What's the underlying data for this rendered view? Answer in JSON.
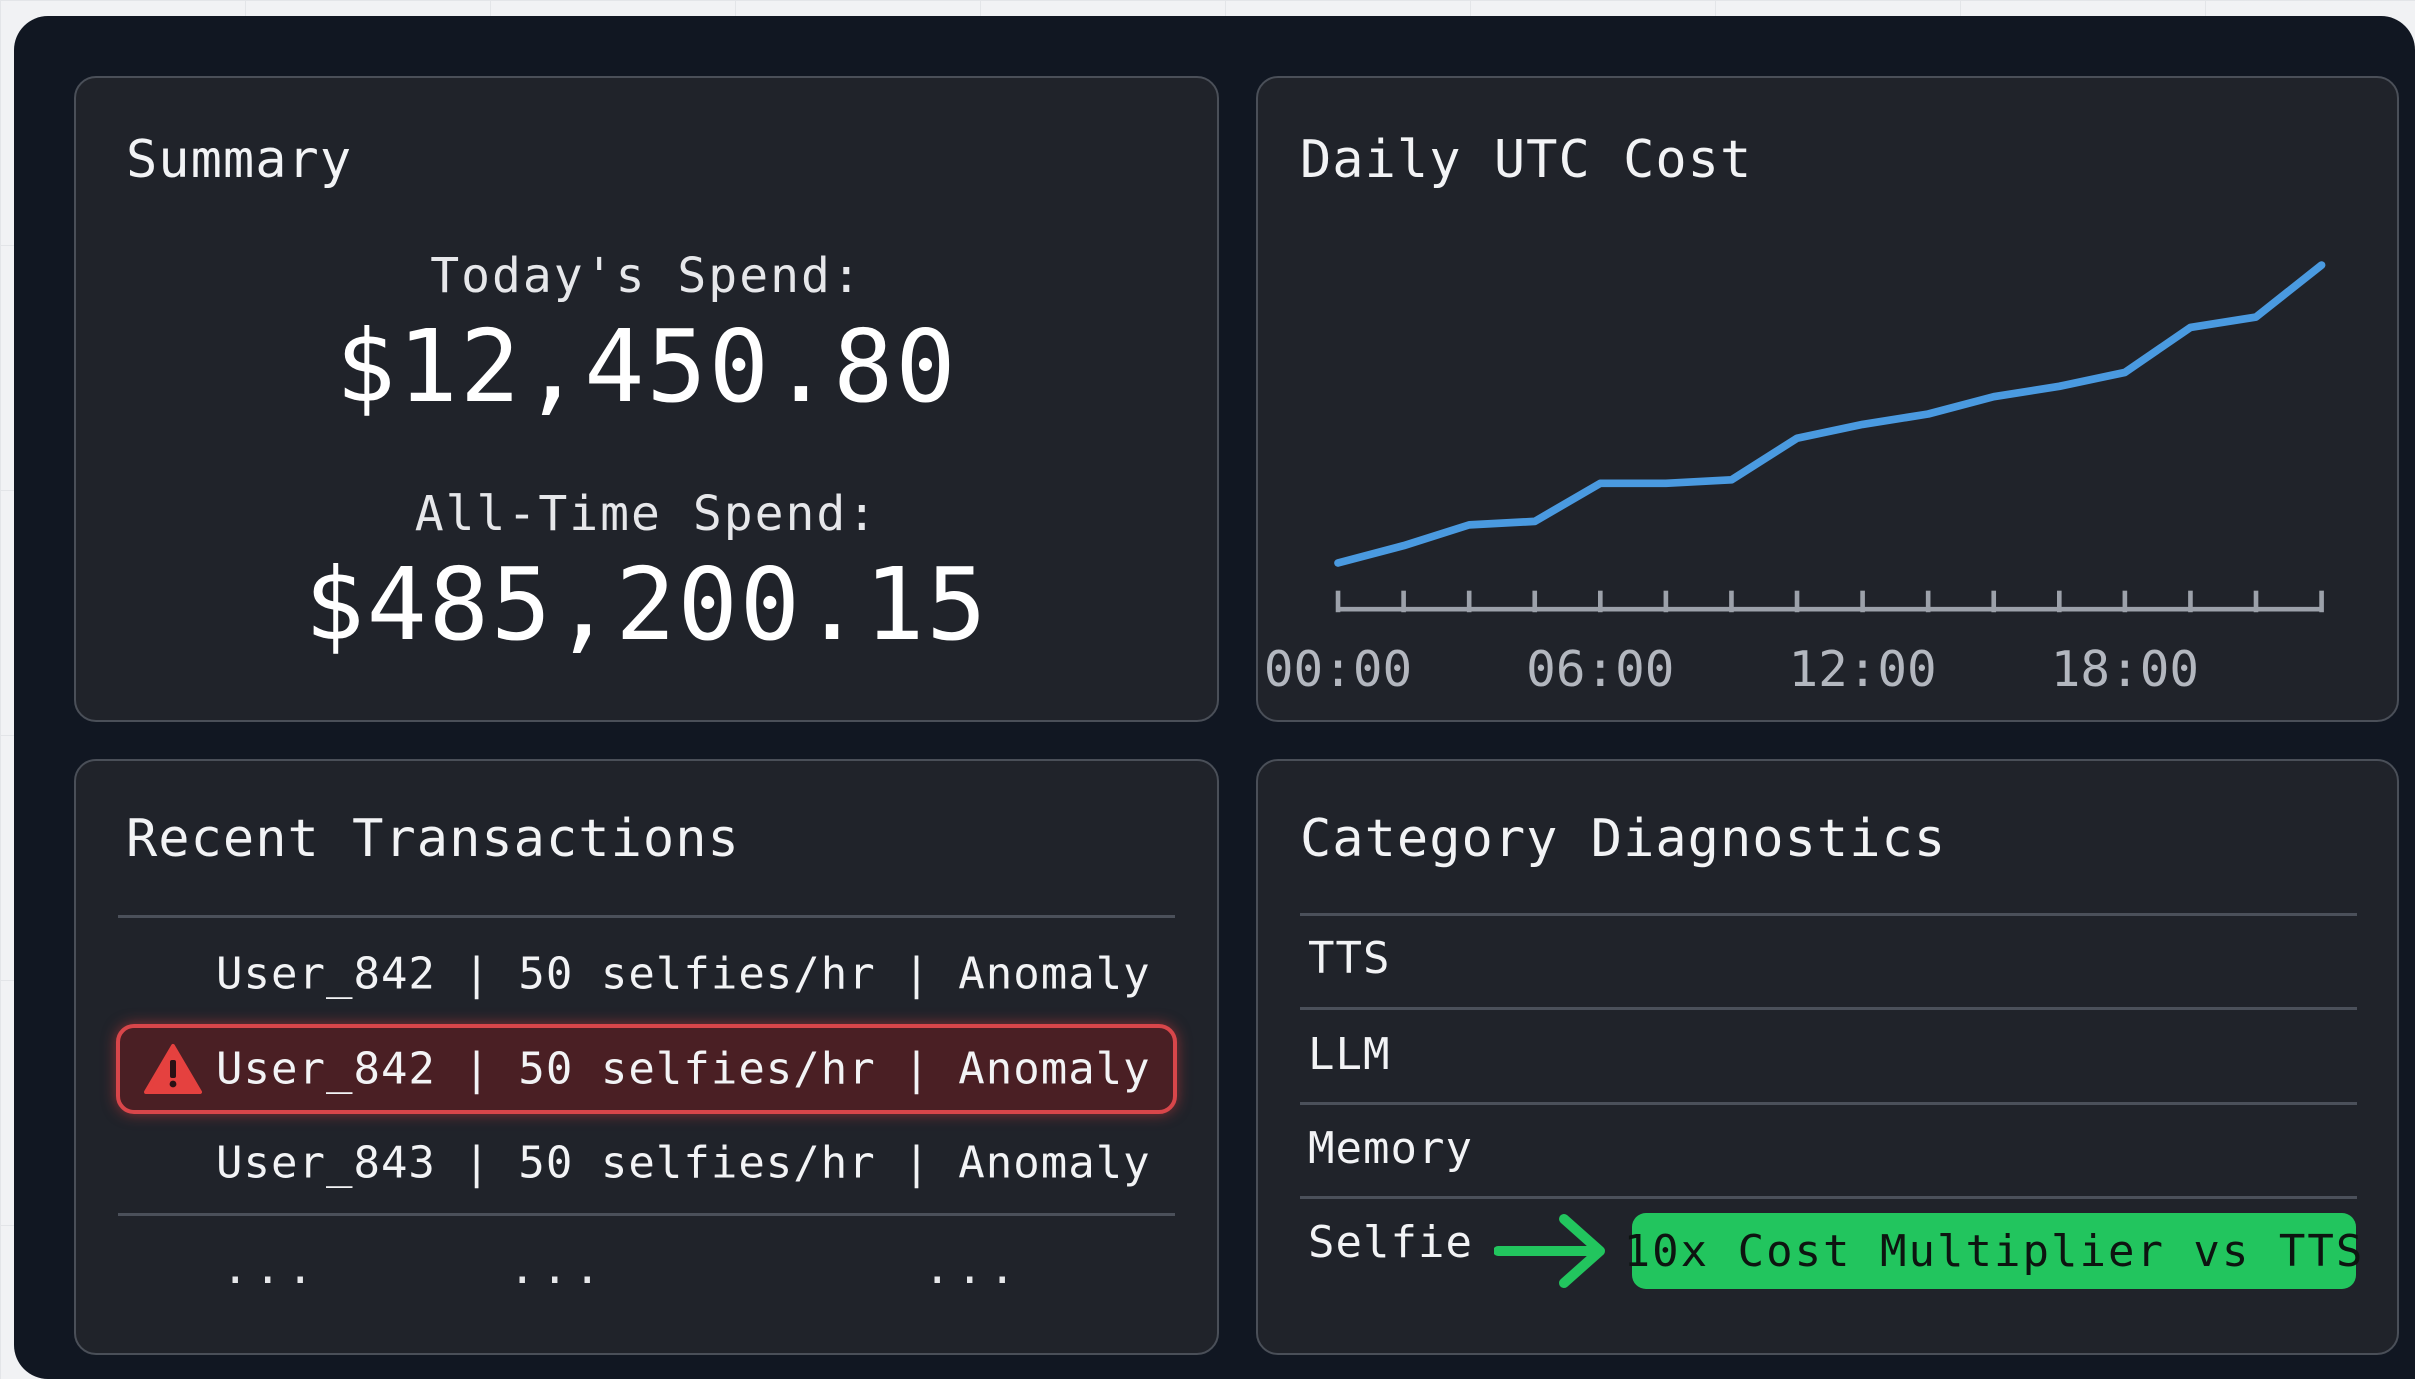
{
  "summary": {
    "title": "Summary",
    "today_label": "Today's Spend:",
    "today_value": "$12,450.80",
    "alltime_label": "All-Time Spend:",
    "alltime_value": "$485,200.15"
  },
  "chart_panel": {
    "title": "Daily UTC Cost"
  },
  "chart_data": {
    "type": "line",
    "title": "Daily UTC Cost",
    "xlabel": "",
    "ylabel": "",
    "x_hours": [
      0,
      1.5,
      3,
      4.5,
      6,
      7.5,
      9,
      10.5,
      12,
      13.5,
      15,
      16.5,
      18,
      19.5,
      21,
      22.5
    ],
    "series": [
      {
        "values": [
          0,
          5,
          11,
          12,
          23,
          23,
          24,
          36,
          40,
          43,
          48,
          51,
          55,
          68,
          71,
          86
        ]
      }
    ],
    "x_ticks": [
      "00:00",
      "06:00",
      "12:00",
      "18:00"
    ],
    "xlim": [
      0,
      22.5
    ],
    "grid": false,
    "line_color": "#4a9ae0"
  },
  "transactions": {
    "title": "Recent Transactions",
    "rows": [
      {
        "text": "User_842 | 50 selfies/hr | Anomaly",
        "flagged": false
      },
      {
        "text": "User_842 | 50 selfies/hr | Anomaly",
        "flagged": true
      },
      {
        "text": "User_843 | 50 selfies/hr | Anomaly",
        "flagged": false
      }
    ],
    "ellipsis": [
      "...",
      "...",
      "..."
    ],
    "warning_icon": "warning-triangle-icon",
    "flag_color": "#d8464a"
  },
  "categories": {
    "title": "Category Diagnostics",
    "items": [
      "TTS",
      "LLM",
      "Memory",
      "Selfie"
    ],
    "arrow_icon": "arrow-right-icon",
    "badge_text": "10x Cost Multiplier vs TTS",
    "badge_color": "#22c55e"
  }
}
